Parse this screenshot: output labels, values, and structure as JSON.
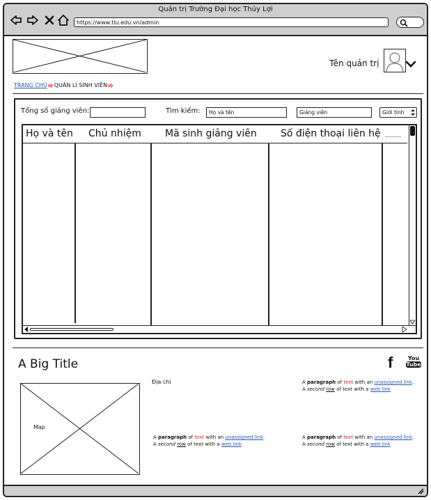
{
  "window": {
    "title": "Quản trị Trường Đại học Thủy Lợi",
    "url": "https://www.tlu.edu.vn/admin"
  },
  "header": {
    "admin_name": "Tên quản trị"
  },
  "breadcrumb": {
    "home": "TRANG CHỦ",
    "current": "QUẢN LÍ SINH VIÊN"
  },
  "filters": {
    "total_label": "Tổng số giảng viên:",
    "search_label": "Tìm kiếm:",
    "name_field": "Họ và tên",
    "role_field": "Giảng viên",
    "gender_select": "Giới tính"
  },
  "table": {
    "columns": [
      "Họ và tên",
      "Chủ nhiệm",
      "Mã sinh giảng viên",
      "Số điện thoại liên hệ",
      "........"
    ]
  },
  "footer": {
    "title": "A Big Title",
    "address_label": "Địa chỉ",
    "map_label": "Map",
    "social": {
      "facebook": "f",
      "youtube_top": "You",
      "youtube_bottom": "Tube"
    },
    "paragraph": {
      "a": "A ",
      "paragraph": "paragraph",
      "of": " of ",
      "text": "text",
      "with": " with an ",
      "unassigned": "unassigned link",
      "dot": ".",
      "a2": "A ",
      "second": "second",
      "sp": " ",
      "row": "row",
      "of2": " of text with a ",
      "weblink": "web link"
    }
  },
  "colors": {
    "chrome": "#cfcfcf",
    "link": "#2a5ab0",
    "accent": "#d22"
  }
}
